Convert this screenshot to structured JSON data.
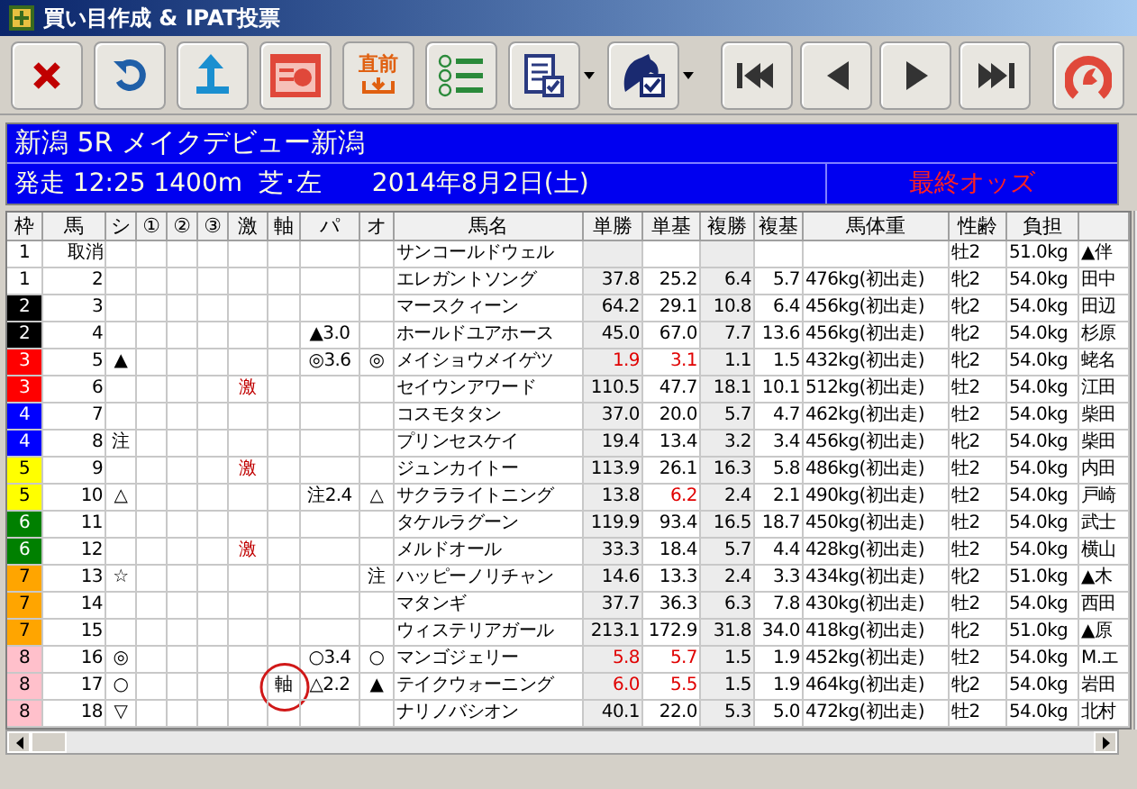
{
  "window": {
    "title": "買い目作成 & IPAT投票"
  },
  "toolbar": {
    "pre_race_label": "直前"
  },
  "race": {
    "title": "新潟 5R メイクデビュー新潟",
    "details": "発走 12:25 1400m  芝･左",
    "date": "2014年8月2日(土)",
    "odds_status": "最終オッズ"
  },
  "table": {
    "columns": [
      "枠",
      "馬",
      "シ",
      "①",
      "②",
      "③",
      "激",
      "軸",
      "パ",
      "オ",
      "馬名",
      "単勝",
      "単基",
      "複勝",
      "複基",
      "馬体重",
      "性齢",
      "負担",
      ""
    ],
    "rows": [
      {
        "frame": "1",
        "color": "#ffffff",
        "number": "取消",
        "shi": "",
        "c1": "",
        "c2": "",
        "c3": "",
        "geki": "",
        "axis": "",
        "circled": false,
        "pa": "",
        "o": "",
        "name": "サンコールドウェル",
        "win": "",
        "win_base": "",
        "place": "",
        "place_base": "",
        "weight": "",
        "sex_age": "牡2",
        "burden": "51.0kg",
        "jockey": "▲伴"
      },
      {
        "frame": "1",
        "color": "#ffffff",
        "number": "2",
        "shi": "",
        "c1": "",
        "c2": "",
        "c3": "",
        "geki": "",
        "axis": "",
        "circled": false,
        "pa": "",
        "o": "",
        "name": "エレガントソング",
        "win": "37.8",
        "win_hot": false,
        "win_base": "25.2",
        "win_base_hot": false,
        "place": "6.4",
        "place_base": "5.7",
        "weight": "476kg(初出走)",
        "sex_age": "牝2",
        "burden": "54.0kg",
        "jockey": "田中"
      },
      {
        "frame": "2",
        "color": "#000000",
        "number": "3",
        "shi": "",
        "c1": "",
        "c2": "",
        "c3": "",
        "geki": "",
        "axis": "",
        "circled": false,
        "pa": "",
        "o": "",
        "name": "マースクィーン",
        "win": "64.2",
        "win_hot": false,
        "win_base": "29.1",
        "win_base_hot": false,
        "place": "10.8",
        "place_base": "6.4",
        "weight": "456kg(初出走)",
        "sex_age": "牝2",
        "burden": "54.0kg",
        "jockey": "田辺"
      },
      {
        "frame": "2",
        "color": "#000000",
        "number": "4",
        "shi": "",
        "c1": "",
        "c2": "",
        "c3": "",
        "geki": "",
        "axis": "",
        "circled": false,
        "pa": "▲3.0",
        "o": "",
        "name": "ホールドユアホース",
        "win": "45.0",
        "win_hot": false,
        "win_base": "67.0",
        "win_base_hot": false,
        "place": "7.7",
        "place_base": "13.6",
        "weight": "456kg(初出走)",
        "sex_age": "牝2",
        "burden": "54.0kg",
        "jockey": "杉原"
      },
      {
        "frame": "3",
        "color": "#ff0000",
        "number": "5",
        "shi": "▲",
        "c1": "",
        "c2": "",
        "c3": "",
        "geki": "",
        "axis": "",
        "circled": false,
        "pa": "◎3.6",
        "o": "◎",
        "name": "メイショウメイゲツ",
        "win": "1.9",
        "win_hot": true,
        "win_base": "3.1",
        "win_base_hot": true,
        "place": "1.1",
        "place_base": "1.5",
        "weight": "432kg(初出走)",
        "sex_age": "牝2",
        "burden": "54.0kg",
        "jockey": "蛯名"
      },
      {
        "frame": "3",
        "color": "#ff0000",
        "number": "6",
        "shi": "",
        "c1": "",
        "c2": "",
        "c3": "",
        "geki": "激",
        "axis": "",
        "circled": false,
        "pa": "",
        "o": "",
        "name": "セイウンアワード",
        "win": "110.5",
        "win_hot": false,
        "win_base": "47.7",
        "win_base_hot": false,
        "place": "18.1",
        "place_base": "10.1",
        "weight": "512kg(初出走)",
        "sex_age": "牡2",
        "burden": "54.0kg",
        "jockey": "江田"
      },
      {
        "frame": "4",
        "color": "#0000ff",
        "number": "7",
        "shi": "",
        "c1": "",
        "c2": "",
        "c3": "",
        "geki": "",
        "axis": "",
        "circled": false,
        "pa": "",
        "o": "",
        "name": "コスモタタン",
        "win": "37.0",
        "win_hot": false,
        "win_base": "20.0",
        "win_base_hot": false,
        "place": "5.7",
        "place_base": "4.7",
        "weight": "462kg(初出走)",
        "sex_age": "牡2",
        "burden": "54.0kg",
        "jockey": "柴田"
      },
      {
        "frame": "4",
        "color": "#0000ff",
        "number": "8",
        "shi": "注",
        "c1": "",
        "c2": "",
        "c3": "",
        "geki": "",
        "axis": "",
        "circled": false,
        "pa": "",
        "o": "",
        "name": "プリンセスケイ",
        "win": "19.4",
        "win_hot": false,
        "win_base": "13.4",
        "win_base_hot": false,
        "place": "3.2",
        "place_base": "3.4",
        "weight": "456kg(初出走)",
        "sex_age": "牝2",
        "burden": "54.0kg",
        "jockey": "柴田"
      },
      {
        "frame": "5",
        "color": "#ffff00",
        "number": "9",
        "shi": "",
        "c1": "",
        "c2": "",
        "c3": "",
        "geki": "激",
        "axis": "",
        "circled": false,
        "pa": "",
        "o": "",
        "name": "ジュンカイトー",
        "win": "113.9",
        "win_hot": false,
        "win_base": "26.1",
        "win_base_hot": false,
        "place": "16.3",
        "place_base": "5.8",
        "weight": "486kg(初出走)",
        "sex_age": "牡2",
        "burden": "54.0kg",
        "jockey": "内田"
      },
      {
        "frame": "5",
        "color": "#ffff00",
        "number": "10",
        "shi": "△",
        "c1": "",
        "c2": "",
        "c3": "",
        "geki": "",
        "axis": "",
        "circled": false,
        "pa": "注2.4",
        "o": "△",
        "name": "サクラライトニング",
        "win": "13.8",
        "win_hot": false,
        "win_base": "6.2",
        "win_base_hot": true,
        "place": "2.4",
        "place_base": "2.1",
        "weight": "490kg(初出走)",
        "sex_age": "牡2",
        "burden": "54.0kg",
        "jockey": "戸崎"
      },
      {
        "frame": "6",
        "color": "#008000",
        "number": "11",
        "shi": "",
        "c1": "",
        "c2": "",
        "c3": "",
        "geki": "",
        "axis": "",
        "circled": false,
        "pa": "",
        "o": "",
        "name": "タケルラグーン",
        "win": "119.9",
        "win_hot": false,
        "win_base": "93.4",
        "win_base_hot": false,
        "place": "16.5",
        "place_base": "18.7",
        "weight": "450kg(初出走)",
        "sex_age": "牡2",
        "burden": "54.0kg",
        "jockey": "武士"
      },
      {
        "frame": "6",
        "color": "#008000",
        "number": "12",
        "shi": "",
        "c1": "",
        "c2": "",
        "c3": "",
        "geki": "激",
        "axis": "",
        "circled": false,
        "pa": "",
        "o": "",
        "name": "メルドオール",
        "win": "33.3",
        "win_hot": false,
        "win_base": "18.4",
        "win_base_hot": false,
        "place": "5.7",
        "place_base": "4.4",
        "weight": "428kg(初出走)",
        "sex_age": "牡2",
        "burden": "54.0kg",
        "jockey": "横山"
      },
      {
        "frame": "7",
        "color": "#ffa500",
        "number": "13",
        "shi": "☆",
        "c1": "",
        "c2": "",
        "c3": "",
        "geki": "",
        "axis": "",
        "circled": false,
        "pa": "",
        "o": "注",
        "name": "ハッピーノリチャン",
        "win": "14.6",
        "win_hot": false,
        "win_base": "13.3",
        "win_base_hot": false,
        "place": "2.4",
        "place_base": "3.3",
        "weight": "434kg(初出走)",
        "sex_age": "牝2",
        "burden": "51.0kg",
        "jockey": "▲木"
      },
      {
        "frame": "7",
        "color": "#ffa500",
        "number": "14",
        "shi": "",
        "c1": "",
        "c2": "",
        "c3": "",
        "geki": "",
        "axis": "",
        "circled": false,
        "pa": "",
        "o": "",
        "name": "マタンギ",
        "win": "37.7",
        "win_hot": false,
        "win_base": "36.3",
        "win_base_hot": false,
        "place": "6.3",
        "place_base": "7.8",
        "weight": "430kg(初出走)",
        "sex_age": "牡2",
        "burden": "54.0kg",
        "jockey": "西田"
      },
      {
        "frame": "7",
        "color": "#ffa500",
        "number": "15",
        "shi": "",
        "c1": "",
        "c2": "",
        "c3": "",
        "geki": "",
        "axis": "",
        "circled": false,
        "pa": "",
        "o": "",
        "name": "ウィステリアガール",
        "win": "213.1",
        "win_hot": false,
        "win_base": "172.9",
        "win_base_hot": false,
        "place": "31.8",
        "place_base": "34.0",
        "weight": "418kg(初出走)",
        "sex_age": "牝2",
        "burden": "51.0kg",
        "jockey": "▲原"
      },
      {
        "frame": "8",
        "color": "#ffc0cb",
        "number": "16",
        "shi": "◎",
        "c1": "",
        "c2": "",
        "c3": "",
        "geki": "",
        "axis": "",
        "circled": false,
        "pa": "○3.4",
        "o": "○",
        "name": "マンゴジェリー",
        "win": "5.8",
        "win_hot": true,
        "win_base": "5.7",
        "win_base_hot": true,
        "place": "1.5",
        "place_base": "1.9",
        "weight": "452kg(初出走)",
        "sex_age": "牡2",
        "burden": "54.0kg",
        "jockey": "M.エ"
      },
      {
        "frame": "8",
        "color": "#ffc0cb",
        "number": "17",
        "shi": "○",
        "c1": "",
        "c2": "",
        "c3": "",
        "geki": "",
        "axis": "軸",
        "circled": true,
        "pa": "△2.2",
        "o": "▲",
        "name": "テイクウォーニング",
        "win": "6.0",
        "win_hot": true,
        "win_base": "5.5",
        "win_base_hot": true,
        "place": "1.5",
        "place_base": "1.9",
        "weight": "464kg(初出走)",
        "sex_age": "牝2",
        "burden": "54.0kg",
        "jockey": "岩田"
      },
      {
        "frame": "8",
        "color": "#ffc0cb",
        "number": "18",
        "shi": "▽",
        "c1": "",
        "c2": "",
        "c3": "",
        "geki": "",
        "axis": "",
        "circled": false,
        "pa": "",
        "o": "",
        "name": "ナリノバシオン",
        "win": "40.1",
        "win_hot": false,
        "win_base": "22.0",
        "win_base_hot": false,
        "place": "5.3",
        "place_base": "5.0",
        "weight": "472kg(初出走)",
        "sex_age": "牡2",
        "burden": "54.0kg",
        "jockey": "北村"
      }
    ]
  }
}
